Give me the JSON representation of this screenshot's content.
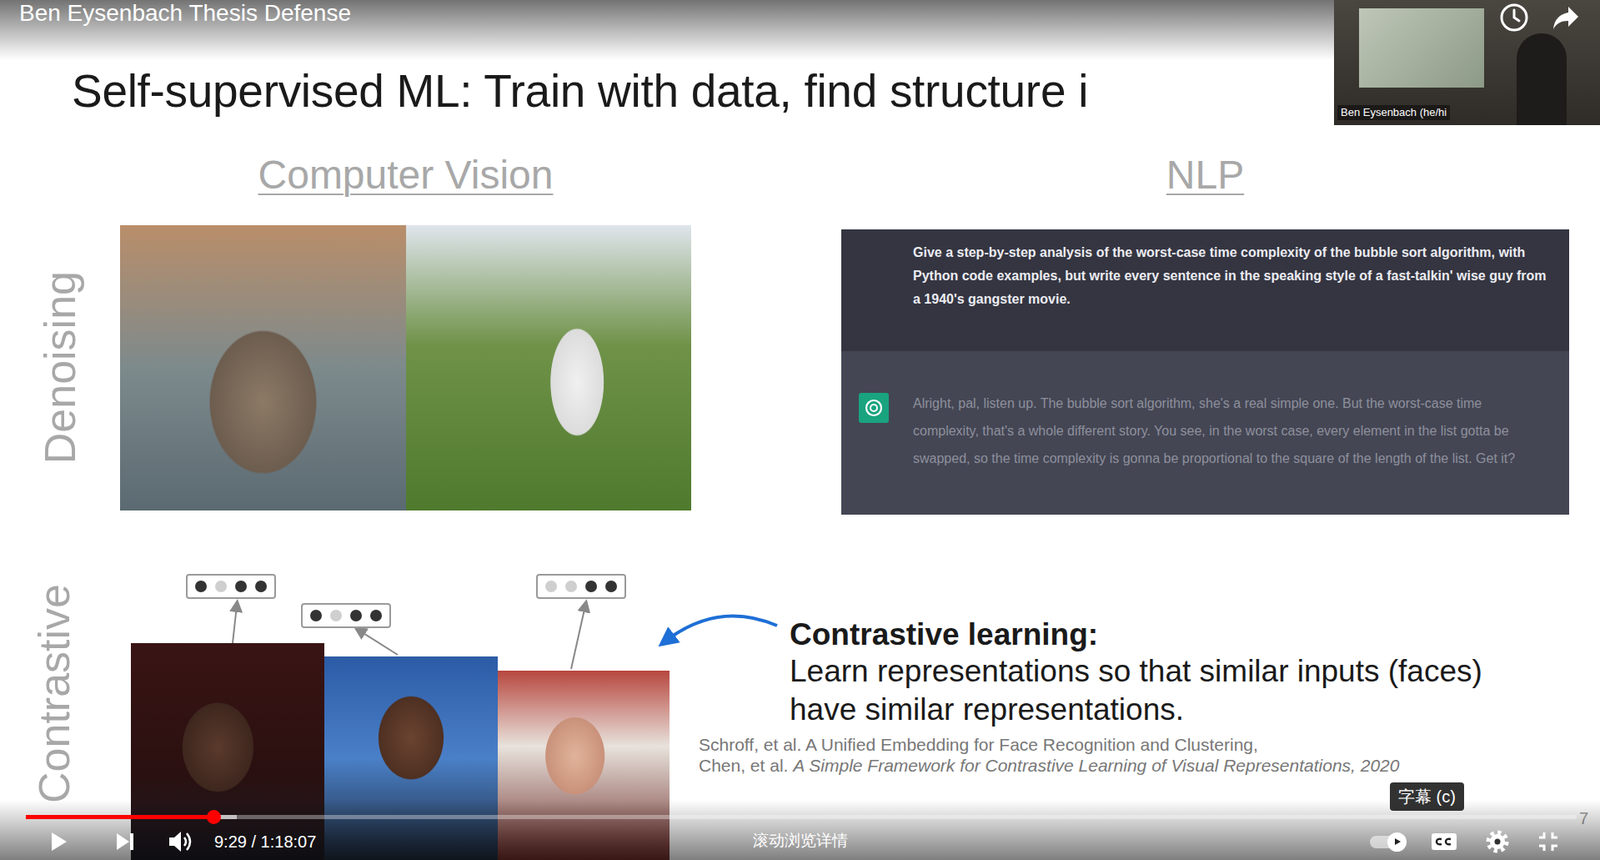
{
  "player": {
    "title": "Ben Eysenbach Thesis Defense",
    "time": "9:29 / 1:18:07",
    "hint": "滚动浏览详情",
    "tooltip": "字幕 (c)",
    "progress": {
      "level": 0.121,
      "buffered": 0.136
    },
    "autoplay": {
      "on": true
    }
  },
  "webcam": {
    "label": "Ben Eysenbach (he/hi"
  },
  "slide": {
    "title": "Self-supervised ML: Train with data, find structure i",
    "page": "7",
    "columns": [
      "Computer Vision",
      "NLP"
    ],
    "rows": [
      "Denoising",
      "Contrastive"
    ],
    "chat": {
      "prompt": "Give a step-by-step analysis of the worst-case time complexity of the bubble sort algorithm, with Python code examples, but write every sentence in the speaking style of a fast-talkin' wise guy from a 1940's gangster movie.",
      "response": "Alright, pal, listen up. The bubble sort algorithm, she's a real simple one. But the worst-case time complexity, that's a whole different story. You see, in the worst case, every element in the list gotta be swapped, so the time complexity is gonna be proportional to the square of the length of the list. Get it?"
    },
    "embeddings": [
      {
        "dots": [
          true,
          false,
          true,
          true
        ]
      },
      {
        "dots": [
          true,
          false,
          true,
          true
        ]
      },
      {
        "dots": [
          false,
          false,
          true,
          true
        ]
      }
    ],
    "contrastive": {
      "heading": "Contrastive learning:",
      "body": "Learn representations so that similar inputs (faces) have similar representations."
    },
    "citations": [
      {
        "authors": "Schroff, et al.",
        "work": "A Unified Embedding for Face Recognition and Clustering,",
        "italic": false
      },
      {
        "authors": "Chen, et al.",
        "work": "A Simple Framework for Contrastive Learning of Visual Representations, 2020",
        "italic": true
      }
    ]
  }
}
